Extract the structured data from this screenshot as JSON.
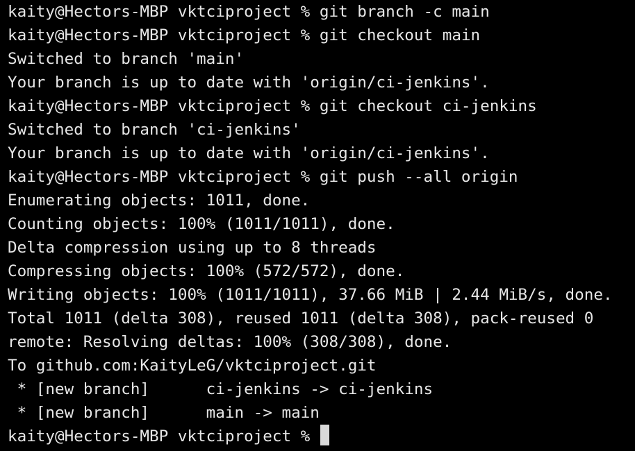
{
  "terminal": {
    "lines": [
      "kaity@Hectors-MBP vktciproject % git branch -c main",
      "kaity@Hectors-MBP vktciproject % git checkout main",
      "Switched to branch 'main'",
      "Your branch is up to date with 'origin/ci-jenkins'.",
      "kaity@Hectors-MBP vktciproject % git checkout ci-jenkins",
      "Switched to branch 'ci-jenkins'",
      "Your branch is up to date with 'origin/ci-jenkins'.",
      "kaity@Hectors-MBP vktciproject % git push --all origin",
      "Enumerating objects: 1011, done.",
      "Counting objects: 100% (1011/1011), done.",
      "Delta compression using up to 8 threads",
      "Compressing objects: 100% (572/572), done.",
      "Writing objects: 100% (1011/1011), 37.66 MiB | 2.44 MiB/s, done.",
      "Total 1011 (delta 308), reused 1011 (delta 308), pack-reused 0",
      "remote: Resolving deltas: 100% (308/308), done.",
      "To github.com:KaityLeG/vktciproject.git",
      " * [new branch]      ci-jenkins -> ci-jenkins",
      " * [new branch]      main -> main"
    ],
    "prompt": "kaity@Hectors-MBP vktciproject % "
  },
  "colors": {
    "background": "#000000",
    "text": "#e6e6e6",
    "cursor": "#d9d9d9"
  }
}
